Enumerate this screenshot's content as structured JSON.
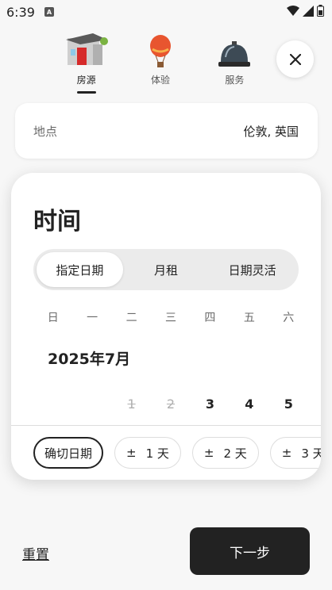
{
  "status_bar": {
    "time": "6:39",
    "app_icon_glyph": "A"
  },
  "categories": [
    {
      "label": "房源",
      "icon": "house-icon",
      "active": true
    },
    {
      "label": "体验",
      "icon": "hot-air-balloon-icon",
      "active": false
    },
    {
      "label": "服务",
      "icon": "service-bell-icon",
      "active": false
    }
  ],
  "location": {
    "label": "地点",
    "value": "伦敦, 英国"
  },
  "time_section": {
    "title": "时间",
    "segments": [
      "指定日期",
      "月租",
      "日期灵活"
    ],
    "active_segment": "指定日期",
    "weekdays": [
      "日",
      "一",
      "二",
      "三",
      "四",
      "五",
      "六"
    ],
    "month_title": "2025年7月",
    "first_week": [
      "",
      "",
      "1",
      "2",
      "3",
      "4",
      "5"
    ],
    "disabled_days": [
      "1",
      "2"
    ],
    "flex_chips": [
      {
        "label": "确切日期",
        "prefix": ""
      },
      {
        "label": "1 天",
        "prefix": "±"
      },
      {
        "label": "2 天",
        "prefix": "±"
      },
      {
        "label": "3 天",
        "prefix": "±"
      }
    ]
  },
  "footer": {
    "reset_label": "重置",
    "next_label": "下一步"
  },
  "colors": {
    "primary": "#222222",
    "background": "#f7f7f7",
    "muted": "#6a6a6a",
    "disabled": "#b0b0b0"
  }
}
